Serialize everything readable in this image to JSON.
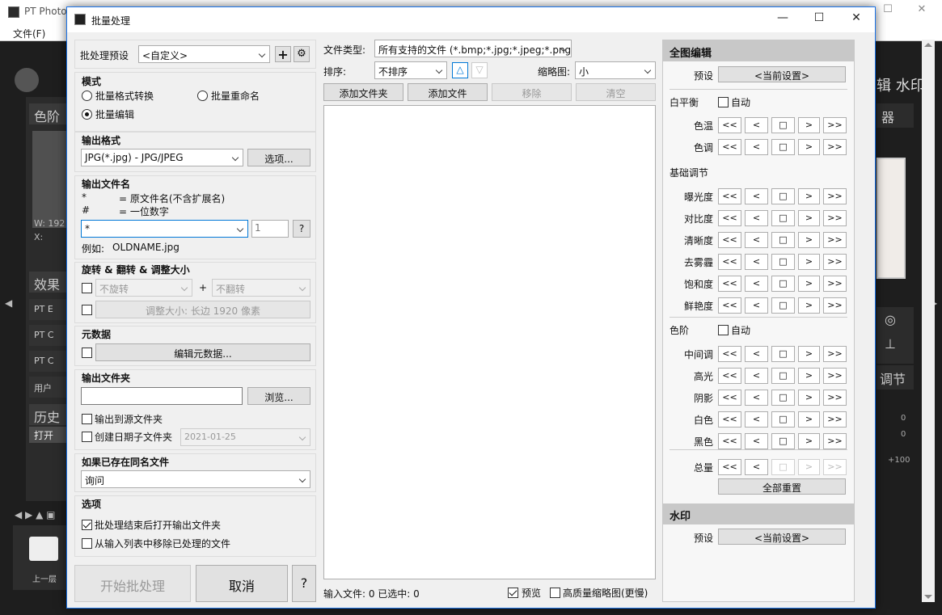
{
  "bg": {
    "app_title": "PT Photo",
    "menu_file": "文件(F)",
    "right_tabs": "辑 水印",
    "open_item": "打开",
    "folder_up": "上一层",
    "left_rows": [
      "PT E",
      "PT C",
      "PT C",
      "用户"
    ],
    "left_sections": [
      "色阶",
      "效果",
      "历史"
    ],
    "info_w": "W:   192",
    "info_x": "X:",
    "right_sec": "器",
    "right_sec2": "调节",
    "right_vals": [
      "0",
      "0",
      "+100"
    ]
  },
  "dialog": {
    "title": "批量处理",
    "preset_label": "批处理预设",
    "preset_value": "<自定义>",
    "mode": {
      "title": "模式",
      "format_convert": "批量格式转换",
      "rename": "批量重命名",
      "edit": "批量编辑"
    },
    "output_format": {
      "title": "输出格式",
      "value": "JPG(*.jpg) - JPG/JPEG",
      "options_btn": "选项..."
    },
    "output_name": {
      "title": "输出文件名",
      "star_sym": "*",
      "star_desc": "= 原文件名(不含扩展名)",
      "hash_sym": "#",
      "hash_desc": "= 一位数字",
      "input_value": "*",
      "num_value": "1",
      "help": "?",
      "example_label": "例如:",
      "example_value": "OLDNAME.jpg"
    },
    "rotate": {
      "title": "旋转 & 翻转 & 调整大小",
      "rotate_value": "不旋转",
      "plus": "+",
      "flip_value": "不翻转",
      "resize_btn": "调整大小: 长边 1920 像素"
    },
    "metadata": {
      "title": "元数据",
      "edit_btn": "编辑元数据..."
    },
    "output_folder": {
      "title": "输出文件夹",
      "browse_btn": "浏览...",
      "to_source": "输出到源文件夹",
      "date_sub": "创建日期子文件夹",
      "date_value": "2021-01-25"
    },
    "exists": {
      "title": "如果已存在同名文件",
      "value": "询问"
    },
    "options": {
      "title": "选项",
      "open_folder": "批处理结束后打开输出文件夹",
      "remove_processed": "从输入列表中移除已处理的文件"
    },
    "start_btn": "开始批处理",
    "cancel_btn": "取消",
    "help_btn": "?",
    "file_type_label": "文件类型:",
    "file_type_value": "所有支持的文件 (*.bmp;*.jpg;*.jpeg;*.png",
    "sort_label": "排序:",
    "sort_value": "不排序",
    "sort_asc": "△",
    "sort_desc": "▽",
    "thumb_label": "缩略图:",
    "thumb_value": "小",
    "add_folder": "添加文件夹",
    "add_file": "添加文件",
    "remove": "移除",
    "clear": "清空",
    "status": "输入文件: 0  已选中: 0",
    "preview": "预览",
    "hq_thumb": "高质量缩略图(更慢)",
    "right": {
      "full_edit": "全图编辑",
      "preset_label": "预设",
      "preset_value": "<当前设置>",
      "wb": "白平衡",
      "auto": "自动",
      "temp": "色温",
      "tint": "色调",
      "basic": "基础调节",
      "exposure": "曝光度",
      "contrast": "对比度",
      "clarity": "清晰度",
      "dehaze": "去雾霾",
      "saturation": "饱和度",
      "vibrance": "鲜艳度",
      "levels": "色阶",
      "mid": "中间调",
      "highlight": "高光",
      "shadow": "阴影",
      "white": "白色",
      "black": "黑色",
      "total": "总量",
      "reset_all": "全部重置",
      "watermark": "水印",
      "wm_preset_label": "预设",
      "wm_preset_value": "<当前设置>",
      "ctrl": [
        "<<",
        "<",
        "□",
        ">",
        ">>"
      ]
    }
  }
}
